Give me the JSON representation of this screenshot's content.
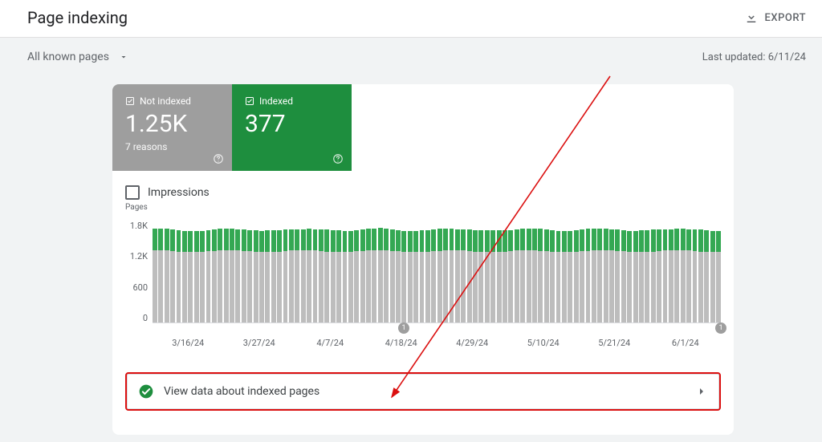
{
  "header": {
    "title": "Page indexing",
    "export_label": "EXPORT"
  },
  "controls": {
    "dropdown_label": "All known pages",
    "last_updated_prefix": "Last updated: ",
    "last_updated_date": "6/11/24"
  },
  "status": {
    "not_indexed": {
      "label": "Not indexed",
      "value": "1.25K",
      "sub": "7 reasons"
    },
    "indexed": {
      "label": "Indexed",
      "value": "377"
    }
  },
  "impressions_label": "Impressions",
  "chart_data": {
    "type": "bar",
    "title": "Pages",
    "ylabel": "Pages",
    "ylim": [
      0,
      1800
    ],
    "y_ticks": [
      "1.8K",
      "1.2K",
      "600",
      "0"
    ],
    "x_categories": [
      "3/16/24",
      "3/27/24",
      "4/7/24",
      "4/18/24",
      "4/29/24",
      "5/10/24",
      "5/21/24",
      "6/1/24"
    ],
    "series_names": [
      "Indexed",
      "Not indexed"
    ],
    "colors": {
      "indexed": "#34a853",
      "not_indexed": "#bdbdbd"
    },
    "bar_count": 96,
    "approx_indexed_per_bar": 377,
    "approx_not_indexed_per_bar": 1250,
    "markers": [
      {
        "index": 42,
        "label": "1"
      },
      {
        "index": 95,
        "label": "1"
      }
    ]
  },
  "link_row": {
    "label": "View data about indexed pages"
  }
}
